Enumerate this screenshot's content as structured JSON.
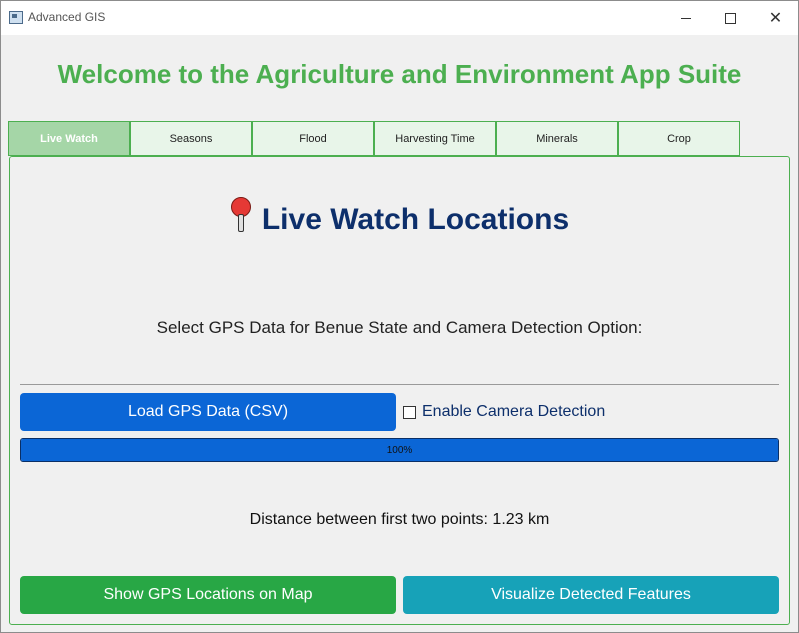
{
  "window": {
    "title": "Advanced GIS"
  },
  "header": {
    "welcome": "Welcome to the Agriculture and Environment App Suite"
  },
  "tabs": [
    {
      "label": "Live Watch",
      "active": true
    },
    {
      "label": "Seasons",
      "active": false
    },
    {
      "label": "Flood",
      "active": false
    },
    {
      "label": "Harvesting Time",
      "active": false
    },
    {
      "label": "Minerals",
      "active": false
    },
    {
      "label": "Crop",
      "active": false
    }
  ],
  "main": {
    "heading": "Live Watch Locations",
    "heading_icon": "pushpin-icon",
    "subtitle": "Select GPS Data for Benue State and Camera Detection Option:",
    "load_button": "Load GPS Data (CSV)",
    "camera_checkbox": {
      "label": "Enable Camera Detection",
      "checked": false
    },
    "progress": {
      "value": 1.0,
      "text": "100%"
    },
    "distance_text": "Distance between first two points: 1.23 km",
    "show_map_button": "Show GPS Locations on Map",
    "visualize_button": "Visualize Detected Features"
  },
  "colors": {
    "accent_green": "#4caf50",
    "heading_navy": "#0d2f6b",
    "primary_blue": "#0b66d6",
    "success_green": "#28a745",
    "info_teal": "#17a2b8"
  }
}
